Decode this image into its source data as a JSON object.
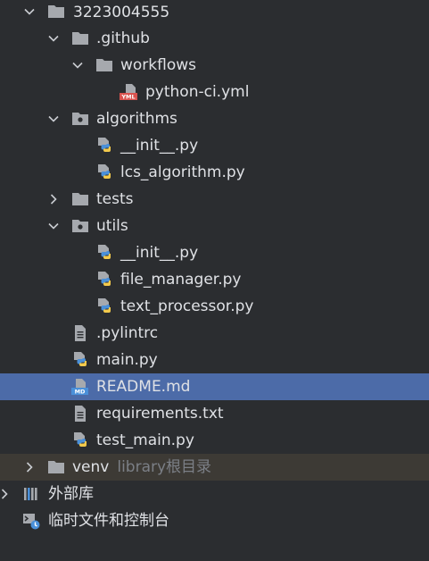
{
  "tree": {
    "root": "3223004555",
    "github": ".github",
    "workflows": "workflows",
    "python_ci": "python-ci.yml",
    "algorithms": "algorithms",
    "alg_init": "__init__.py",
    "lcs": "lcs_algorithm.py",
    "tests": "tests",
    "utils": "utils",
    "utils_init": "__init__.py",
    "file_manager": "file_manager.py",
    "text_processor": "text_processor.py",
    "pylintrc": ".pylintrc",
    "main": "main.py",
    "readme": "README.md",
    "requirements": "requirements.txt",
    "test_main": "test_main.py",
    "venv": "venv",
    "venv_hint": "library根目录",
    "external_libs": "外部库",
    "scratches": "临时文件和控制台"
  },
  "icons": {
    "folder": "folder-icon",
    "module_folder": "module-folder-icon",
    "python_file": "python-file-icon",
    "yaml_file": "yaml-file-icon",
    "text_file": "text-file-icon",
    "markdown_file": "markdown-file-icon",
    "library": "library-icon",
    "scratch": "scratch-icon"
  },
  "colors": {
    "background": "#2b2d30",
    "selection": "#4c6ba8",
    "venv_row": "#3d3a35",
    "text": "#dfe1e5",
    "hint": "#7b7f86"
  }
}
